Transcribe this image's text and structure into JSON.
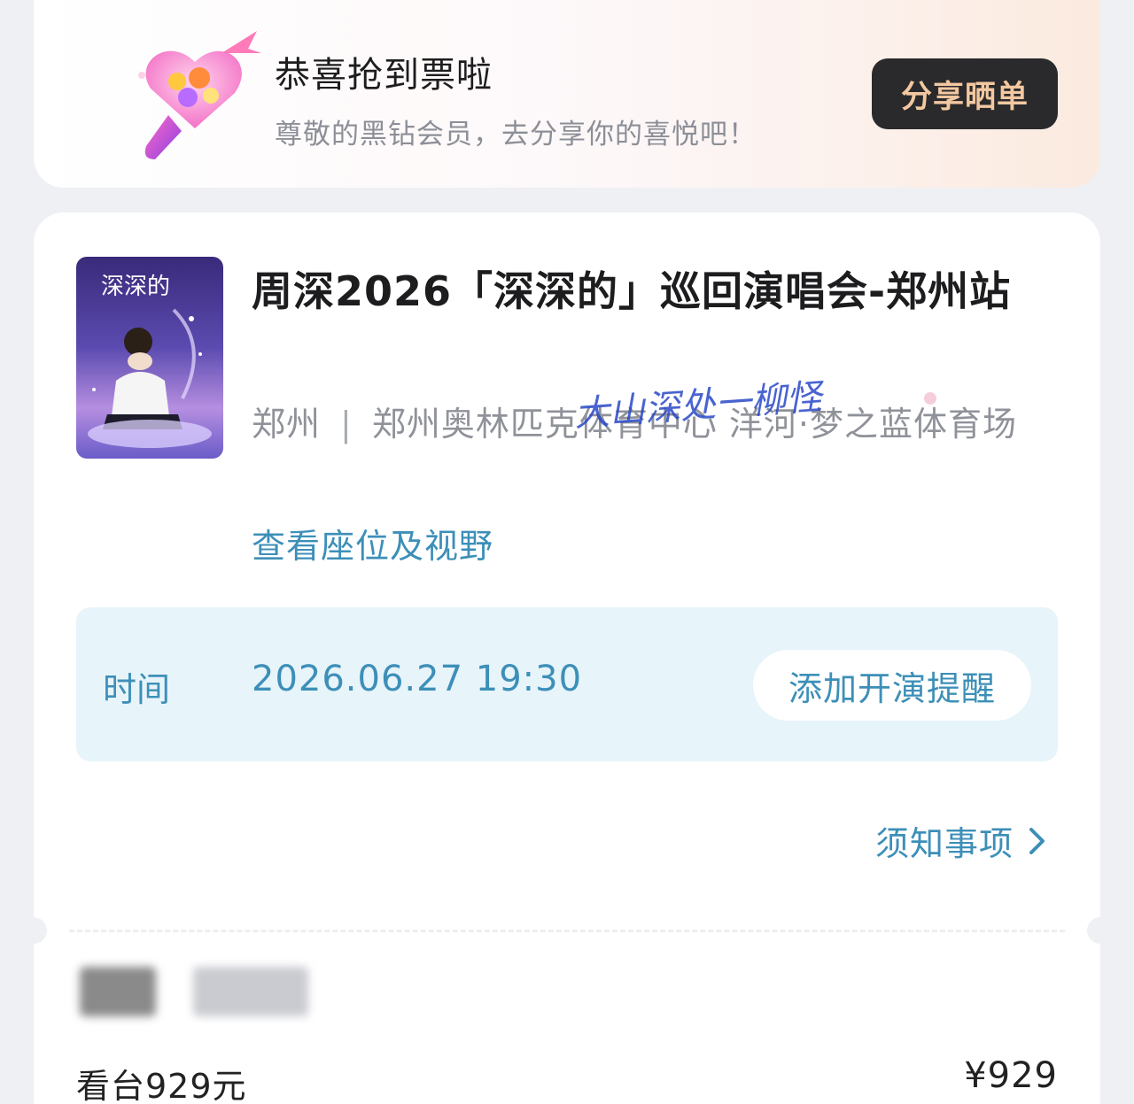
{
  "banner": {
    "title": "恭喜抢到票啦",
    "subtitle": "尊敬的黑钻会员，去分享你的喜悦吧！",
    "share_label": "分享晒单",
    "icon": "light-stick-icon"
  },
  "event": {
    "title": "周深2026「深深的」巡回演唱会-郑州站",
    "city": "郑州",
    "separator": "|",
    "venue": "郑州奥林匹克体育中心 洋河·梦之蓝体育场",
    "seat_link": "查看座位及视野",
    "poster": {
      "title_text": "深深的"
    }
  },
  "watermark": {
    "text": "大山深处一柳怪"
  },
  "time": {
    "label": "时间",
    "value": "2026.06.27 19:30",
    "remind_label": "添加开演提醒"
  },
  "notice": {
    "label": "须知事项",
    "icon": "chevron-right-icon"
  },
  "ticket": {
    "price_label": "看台929元",
    "price_value": "¥929"
  },
  "colors": {
    "accent": "#3d8fb8",
    "time_box_bg": "#e7f4fa",
    "share_btn_bg": "#2a2a2c",
    "share_btn_text": "#f3c8a0"
  }
}
